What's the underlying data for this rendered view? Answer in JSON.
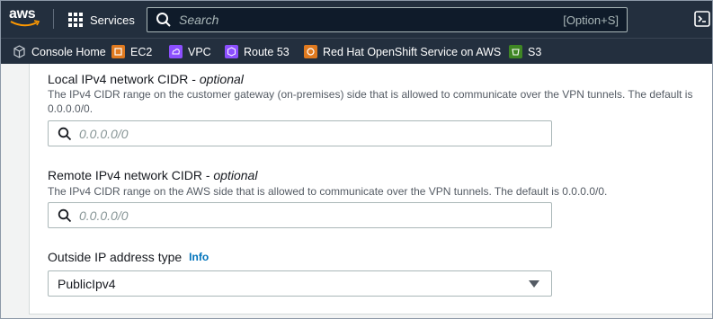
{
  "nav": {
    "logo_text": "aws",
    "services_label": "Services",
    "search_placeholder": "Search",
    "search_shortcut": "[Option+S]",
    "cloudshell_icon": "cloudshell-icon"
  },
  "favorites": [
    {
      "label": "Console Home",
      "icon": "cube-icon",
      "color": "#232f3e"
    },
    {
      "label": "EC2",
      "icon": "ec2-icon",
      "color": "#e07a1f"
    },
    {
      "label": "VPC",
      "icon": "vpc-icon",
      "color": "#8c4fff"
    },
    {
      "label": "Route 53",
      "icon": "route53-icon",
      "color": "#8c4fff"
    },
    {
      "label": "Red Hat OpenShift Service on AWS",
      "icon": "openshift-icon",
      "color": "#e07a1f"
    },
    {
      "label": "S3",
      "icon": "s3-icon",
      "color": "#3f8624"
    }
  ],
  "form": {
    "local_cidr": {
      "label": "Local IPv4 network CIDR - ",
      "optional": "optional",
      "description": "The IPv4 CIDR range on the customer gateway (on-premises) side that is allowed to communicate over the VPN tunnels. The default is 0.0.0.0/0.",
      "placeholder": "0.0.0.0/0"
    },
    "remote_cidr": {
      "label": "Remote IPv4 network CIDR - ",
      "optional": "optional",
      "description": "The IPv4 CIDR range on the AWS side that is allowed to communicate over the VPN tunnels. The default is 0.0.0.0/0.",
      "placeholder": "0.0.0.0/0"
    },
    "outside_ip": {
      "label": "Outside IP address type",
      "info": "Info",
      "selected": "PublicIpv4"
    }
  },
  "colors": {
    "nav_bg": "#232f3e",
    "link": "#0073bb"
  }
}
